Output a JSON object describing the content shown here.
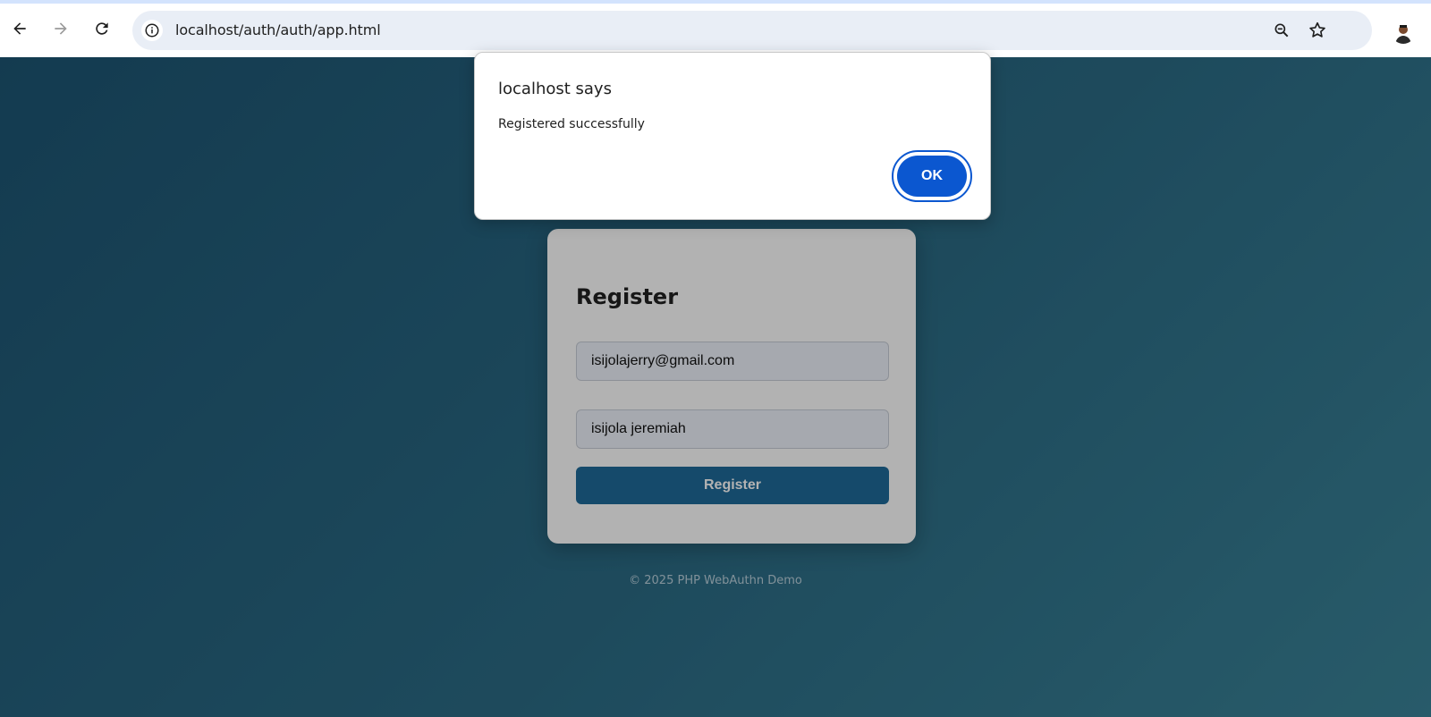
{
  "browser": {
    "url": "localhost/auth/auth/app.html",
    "icons": [
      "back-arrow-icon",
      "forward-arrow-icon",
      "reload-icon",
      "site-info-icon",
      "zoom-icon",
      "bookmark-star-icon",
      "profile-avatar-icon"
    ]
  },
  "page": {
    "card": {
      "title": "Register",
      "email_value": "isijolajerry@gmail.com",
      "name_value": "isijola jeremiah",
      "register_label": "Register"
    },
    "footer": "© 2025 PHP WebAuthn Demo"
  },
  "dialog": {
    "title": "localhost says",
    "message": "Registered successfully",
    "ok_label": "OK"
  },
  "colors": {
    "accent": "#0b57d0",
    "register_button": "#1f6b9a",
    "background_start": "#1d5573",
    "background_end": "#3a8398"
  }
}
